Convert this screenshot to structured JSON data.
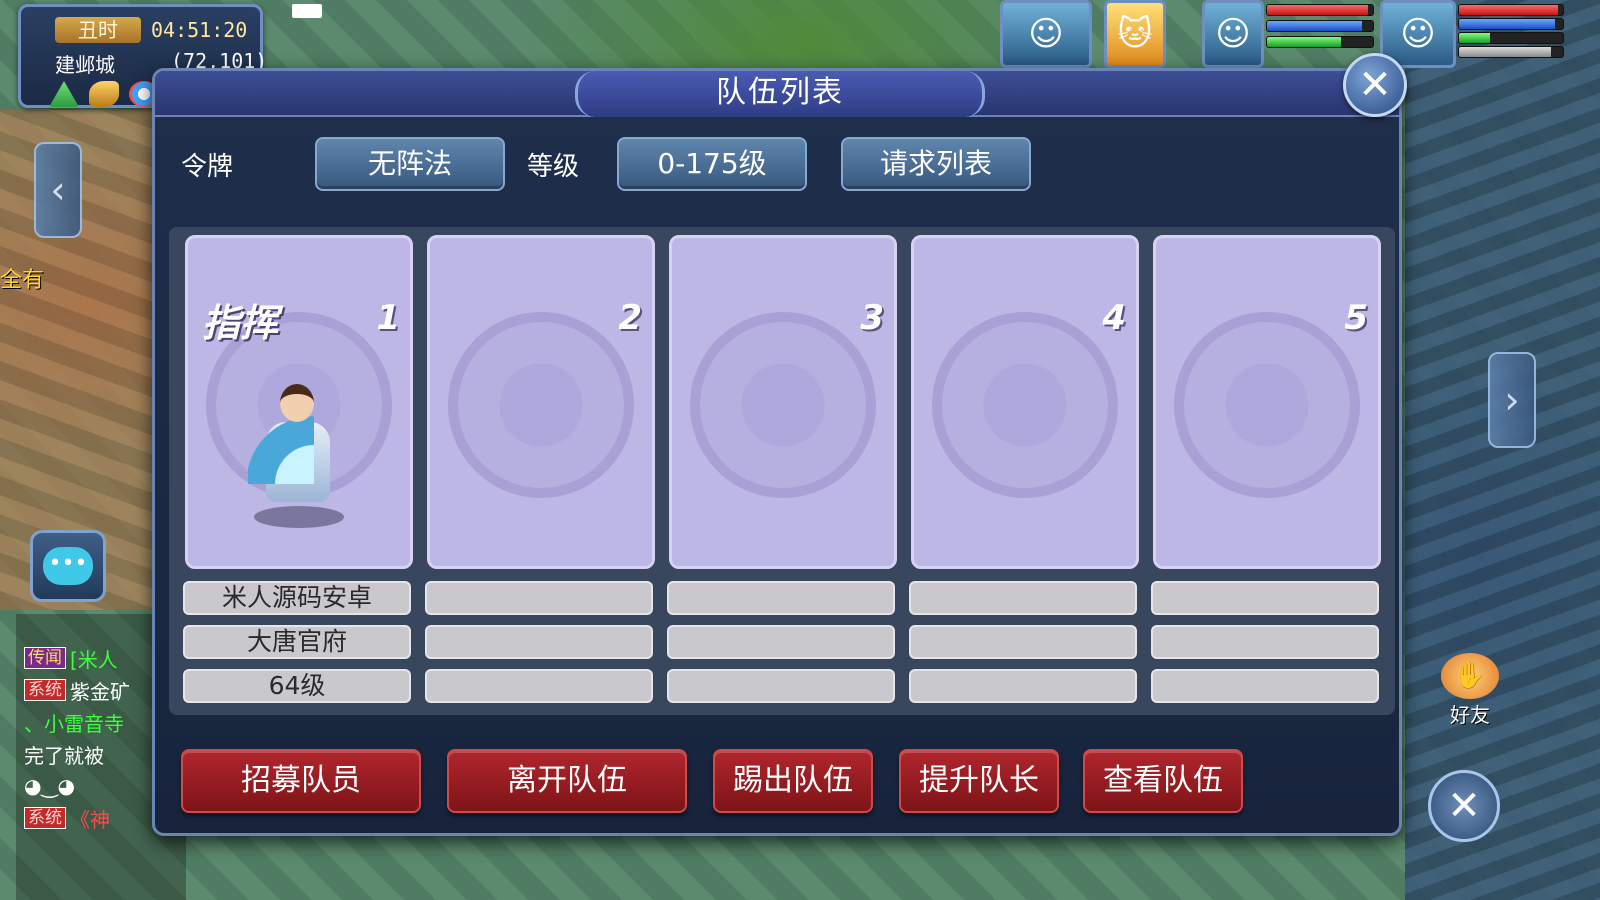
{
  "hud": {
    "period": "丑时",
    "time": "04:51:20",
    "city": "建邺城",
    "coords": "(72,101)"
  },
  "left_label": "全有",
  "chat": [
    {
      "tag": "传闻",
      "tag_type": "rumor",
      "text": "[米人",
      "color": "green"
    },
    {
      "tag": "系统",
      "tag_type": "sys",
      "text": "紫金矿",
      "color": "white"
    },
    {
      "tag": "",
      "tag_type": "",
      "text": "、小雷音寺",
      "color": "green"
    },
    {
      "tag": "",
      "tag_type": "",
      "text": "完了就被",
      "color": "white"
    },
    {
      "tag": "",
      "tag_type": "",
      "text": "",
      "color": "white"
    },
    {
      "tag": "系统",
      "tag_type": "sys",
      "text": "《神",
      "color": "red"
    }
  ],
  "friend_label": "好友",
  "dialog": {
    "title": "队伍列表",
    "token_label": "令牌",
    "formation_value": "无阵法",
    "level_label": "等级",
    "level_range": "0-175级",
    "request_list_label": "请求列表",
    "slots": [
      {
        "number": "1",
        "role": "指挥",
        "name": "米人源码安卓",
        "school": "大唐官府",
        "level": "64级",
        "occupied": true
      },
      {
        "number": "2",
        "role": "",
        "name": "",
        "school": "",
        "level": "",
        "occupied": false
      },
      {
        "number": "3",
        "role": "",
        "name": "",
        "school": "",
        "level": "",
        "occupied": false
      },
      {
        "number": "4",
        "role": "",
        "name": "",
        "school": "",
        "level": "",
        "occupied": false
      },
      {
        "number": "5",
        "role": "",
        "name": "",
        "school": "",
        "level": "",
        "occupied": false
      }
    ],
    "actions": {
      "recruit": "招募队员",
      "leave": "离开队伍",
      "kick": "踢出队伍",
      "promote": "提升队长",
      "view": "查看队伍"
    }
  },
  "status_bars": {
    "pet": {
      "hp": 0.95,
      "mp": 0.9,
      "sp": 0.7
    },
    "player": {
      "hp": 0.95,
      "mp": 0.92,
      "sp": 0.3,
      "exp": 0.88
    }
  },
  "colors": {
    "dialog_bg": "#1f2f4c",
    "slot_card": "#bdb7e6",
    "action_button": "#9e1f25",
    "filter_button": "#4d7098"
  }
}
